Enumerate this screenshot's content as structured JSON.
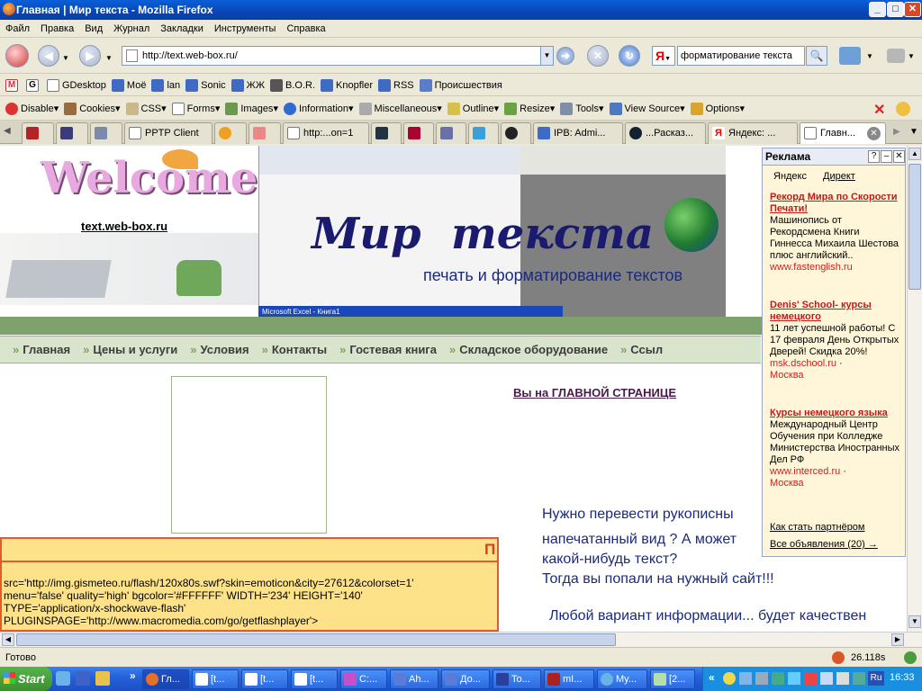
{
  "window": {
    "title": "Главная | Мир текста - Mozilla Firefox",
    "minimize": "_",
    "maximize": "□",
    "close": "✕"
  },
  "menu": [
    "Файл",
    "Правка",
    "Вид",
    "Журнал",
    "Закладки",
    "Инструменты",
    "Справка"
  ],
  "nav": {
    "url": "http://text.web-box.ru/",
    "search_value": "форматирование текста",
    "search_engine": "Я"
  },
  "bookmarks": [
    "GDesktop",
    "Моё",
    "lan",
    "Sonic",
    "ЖЖ",
    "B.O.R.",
    "Knopfler",
    "RSS",
    "Происшествия"
  ],
  "devtools": [
    "Disable",
    "Cookies",
    "CSS",
    "Forms",
    "Images",
    "Information",
    "Miscellaneous",
    "Outline",
    "Resize",
    "Tools",
    "View Source",
    "Options"
  ],
  "tabs": [
    {
      "label": ""
    },
    {
      "label": ""
    },
    {
      "label": ""
    },
    {
      "label": "PPTP Client"
    },
    {
      "label": ""
    },
    {
      "label": ""
    },
    {
      "label": "http:...on=1"
    },
    {
      "label": ""
    },
    {
      "label": ""
    },
    {
      "label": ""
    },
    {
      "label": ""
    },
    {
      "label": ""
    },
    {
      "label": "IPB: Admi..."
    },
    {
      "label": "...Расказ..."
    },
    {
      "label": "Яндекс: ..."
    },
    {
      "label": "Главн..."
    }
  ],
  "page": {
    "welcome_logo_text": "Welcome",
    "site_link": "text.web-box.ru",
    "banner_title": "Мир  текста",
    "banner_subtitle": "печать и форматирование текстов",
    "excel_caption": "Microsoft Excel - Книга1",
    "nav_items": [
      "Главная",
      "Цены и услуги",
      "Условия",
      "Контакты",
      "Гостевая книга",
      "Складское оборудование",
      "Ссыл"
    ],
    "you_are_on": "Вы на ГЛАВНОЙ СТРАНИЦЕ",
    "flash_code": [
      "src='http://img.gismeteo.ru/flash/120x80s.swf?skin=emoticon&city=27612&colorset=1'",
      "menu='false' quality='high' bgcolor='#FFFFFF' WIDTH='234' HEIGHT='140'",
      "TYPE='application/x-shockwave-flash'",
      "PLUGINSPAGE='http://www.macromedia.com/go/getflashplayer'>"
    ],
    "flash_header_letter": "П",
    "main_text": [
      "Нужно перевести рукописны",
      "напечатанный вид ? А может",
      "какой-нибудь текст?",
      "Тогда вы попали на нужный сайт!!!",
      "Любой вариант информации... будет качествен"
    ]
  },
  "ads": {
    "title": "Реклама",
    "tab_yandex": "Яндекс",
    "tab_direct": "Директ",
    "items": [
      {
        "title": "Рекорд Мира по Скорости Печати!",
        "text": "Машинопись от Рекордсмена Книги Гиннесса Михаила Шестова плюс английский..",
        "url": "www.fastenglish.ru",
        "extra": ""
      },
      {
        "title": "Denis' School- курсы немецкого",
        "text": "11 лет успешной работы! С 17 февраля День Открытых Дверей! Скидка 20%!",
        "url": "msk.dschool.ru",
        "extra": "Москва"
      },
      {
        "title": "Курсы немецкого языка",
        "text": "Международный Центр Обучения при Колледже Министерства Иностранных Дел РФ",
        "url": "www.interced.ru",
        "extra": "Москва"
      }
    ],
    "partner": "Как стать партнёром",
    "all_ads": "Все объявления (20) →"
  },
  "status": {
    "text": "Готово",
    "timer": "26.118s"
  },
  "taskbar": {
    "start": "Start",
    "tasks": [
      "Гл...",
      "[t...",
      "[t...",
      "[t...",
      "C:...",
      "Ah...",
      "До...",
      "To...",
      "mI...",
      "My...",
      "[2..."
    ],
    "lang": "Ru",
    "clock": "16:33"
  }
}
